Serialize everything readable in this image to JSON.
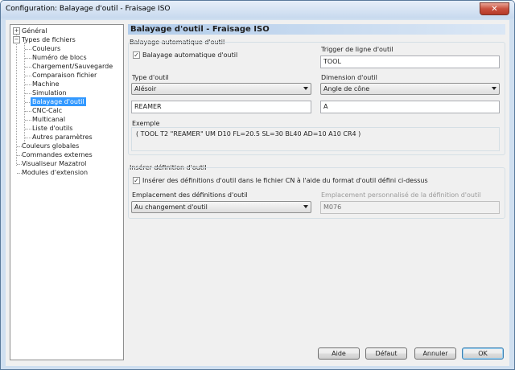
{
  "window": {
    "title": "Configuration: Balayage d'outil - Fraisage ISO",
    "close_label": "✕"
  },
  "tree": {
    "items": [
      {
        "label": "Général",
        "expander": "+"
      },
      {
        "label": "Types de fichiers",
        "expander": "−"
      },
      {
        "label": "Couleurs"
      },
      {
        "label": "Numéro de blocs"
      },
      {
        "label": "Chargement/Sauvegarde"
      },
      {
        "label": "Comparaison fichier"
      },
      {
        "label": "Machine"
      },
      {
        "label": "Simulation"
      },
      {
        "label": "Balayage d'outil",
        "selected": true
      },
      {
        "label": "CNC-Calc"
      },
      {
        "label": "Multicanal"
      },
      {
        "label": "Liste d'outils"
      },
      {
        "label": "Autres paramètres"
      },
      {
        "label": "Couleurs globales"
      },
      {
        "label": "Commandes externes"
      },
      {
        "label": "Visualiseur Mazatrol"
      },
      {
        "label": "Modules d'extension"
      }
    ]
  },
  "panel": {
    "header": "Balayage d'outil - Fraisage ISO",
    "auto": {
      "group_label": "Balayage automatique d'outil",
      "checkbox_label": "Balayage automatique d'outil",
      "checkbox_checked": true,
      "checkbox_mark": "✓",
      "trigger_label": "Trigger de ligne d'outil",
      "trigger_value": "TOOL",
      "type_label": "Type d'outil",
      "type_value": "Alésoir",
      "dimension_label": "Dimension d'outil",
      "dimension_value": "Angle de cône",
      "type_text_value": "REAMER",
      "dimension_text_value": "A",
      "example_label": "Exemple",
      "example_value": "( TOOL T2 \"REAMER\" UM D10 FL=20.5 SL=30 BL40 AD=10 A10 CR4 )"
    },
    "insert": {
      "group_label": "Insérer définition d'outil",
      "checkbox_label": "Insérer des définitions d'outil dans le fichier CN à l'aide du format d'outil défini ci-dessus",
      "checkbox_checked": true,
      "checkbox_mark": "✓",
      "location_label": "Emplacement des définitions d'outil",
      "location_value": "Au changement d'outil",
      "custom_label": "Emplacement personnalisé de la définition d'outil",
      "custom_value": "M076"
    }
  },
  "footer": {
    "help": "Aide",
    "default": "Défaut",
    "cancel": "Annuler",
    "ok": "OK"
  }
}
